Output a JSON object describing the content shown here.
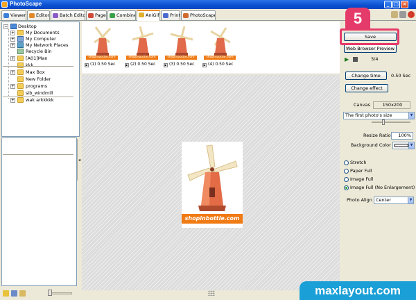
{
  "window": {
    "title": "PhotoScape"
  },
  "tabs": [
    {
      "label": "Viewer",
      "color": "#3a7fd8"
    },
    {
      "label": "Editor",
      "color": "#e08a2e"
    },
    {
      "label": "Batch Editor",
      "color": "#8a5bc7"
    },
    {
      "label": "Page",
      "color": "#d04a3a"
    },
    {
      "label": "Combine",
      "color": "#3aa04a"
    },
    {
      "label": "AniGif",
      "color": "#e0b02e"
    },
    {
      "label": "Print",
      "color": "#4a6ad0"
    },
    {
      "label": "PhotoScape",
      "color": "#d06a2e"
    }
  ],
  "tree": [
    "Desktop",
    "My Documents",
    "My Computer",
    "My Network Places",
    "Recycle Bin",
    "[A01]Man",
    "kkk",
    "Max Box",
    "New Folder",
    "programs",
    "sib_windmill",
    "wak arkkkkk"
  ],
  "frames": [
    {
      "logo": "shopinbottle.com",
      "caption": "(1) 0.50 Sec"
    },
    {
      "logo": "shopinbottle.com",
      "caption": "(2) 0.50 Sec"
    },
    {
      "logo": "shopinbottle.com",
      "caption": "(3) 0.50 Sec"
    },
    {
      "logo": "shopinbottle.com",
      "caption": "(4) 0.50 Sec"
    }
  ],
  "preview": {
    "logo": "shopinbottle.com"
  },
  "panel": {
    "save_label": "Save",
    "web_preview_label": "Web Browser Preview",
    "frame_counter": "3/4",
    "change_time_label": "Change time",
    "time_value": "0.50 Sec",
    "change_effect_label": "Change effect",
    "canvas_label": "Canvas",
    "canvas_size": "150x200",
    "size_mode": "The first photo's size",
    "resize_ratio_label": "Resize Ratio",
    "resize_ratio_value": "100%",
    "bg_color_label": "Background Color",
    "fit_options": [
      "Stretch",
      "Paper Full",
      "Image Full",
      "Image Full (No Enlargement)"
    ],
    "selected_fit": "Image Full (No Enlargement)",
    "photo_align_label": "Photo Align",
    "photo_align_value": "Center"
  },
  "annotation": {
    "step_number": "5"
  },
  "watermark": "maxlayout.com",
  "colors": {
    "accent_pink": "#e53b6a",
    "watermark_blue": "#1a9fd7",
    "logo_orange": "#f07b15"
  }
}
